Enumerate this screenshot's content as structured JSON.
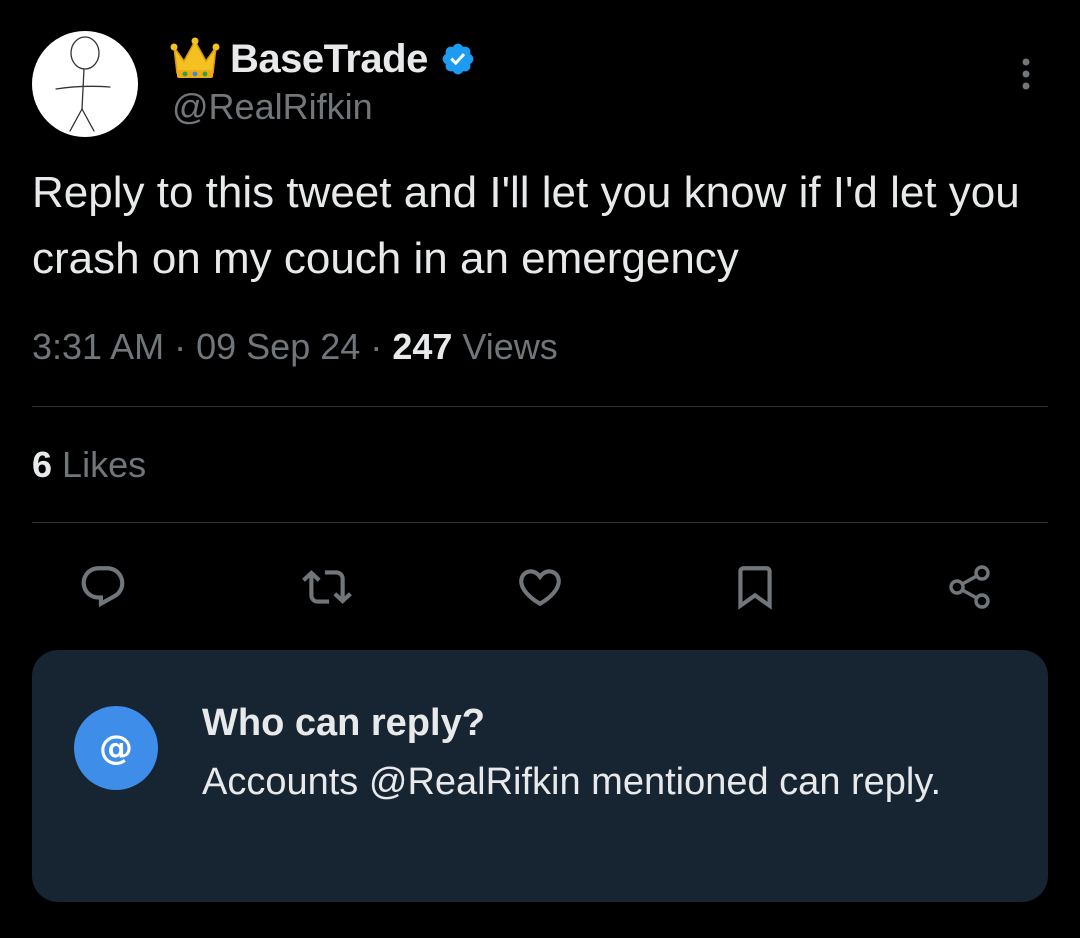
{
  "tweet": {
    "author": {
      "display_name": "BaseTrade",
      "handle": "@RealRifkin",
      "verified": true,
      "name_emoji": "crown-icon"
    },
    "text": "Reply to this tweet and I'll let you know if I'd let you crash on my couch in an emergency",
    "time": "3:31 AM",
    "separator": "·",
    "date": "09 Sep 24",
    "views_count": "247",
    "views_label": "Views",
    "likes_count": "6",
    "likes_label": "Likes",
    "actions": [
      "reply-icon",
      "retweet-icon",
      "like-icon",
      "bookmark-icon",
      "share-icon"
    ]
  },
  "reply_restriction": {
    "title": "Who can reply?",
    "description": "Accounts @RealRifkin mentioned can reply.",
    "icon": "at-sign-icon"
  },
  "colors": {
    "background": "#000000",
    "text_primary": "#e7e9ea",
    "text_secondary": "#71767b",
    "verified_blue": "#1d9bf0",
    "card_background": "#172431",
    "at_icon_background": "#3e8de8"
  }
}
